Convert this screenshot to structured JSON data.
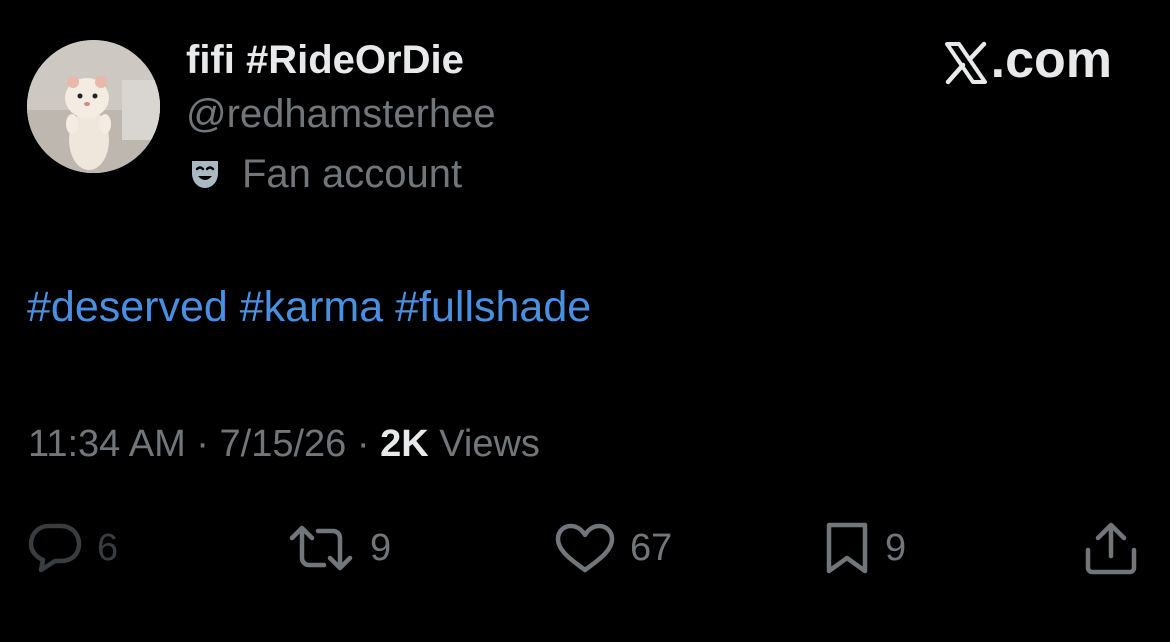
{
  "brand": {
    "text": ".com",
    "logo_icon": "x-logo-icon"
  },
  "author": {
    "display_name": "fifi #RideOrDie",
    "handle": "@redhamsterhee",
    "label": "Fan account",
    "label_icon": "theater-mask-icon"
  },
  "tweet": {
    "hashtags": [
      "#deserved",
      "#karma",
      "#fullshade"
    ]
  },
  "meta": {
    "time": "11:34 AM",
    "sep1": " · ",
    "date": "7/15/26",
    "sep2": " · ",
    "views_count": "2K",
    "views_label": " Views"
  },
  "actions": {
    "replies": "6",
    "reposts": "9",
    "likes": "67",
    "bookmarks": "9"
  },
  "colors": {
    "background": "#000000",
    "text_primary": "#e7e9ea",
    "text_secondary": "#71767b",
    "hashtag": "#4a90e2"
  }
}
